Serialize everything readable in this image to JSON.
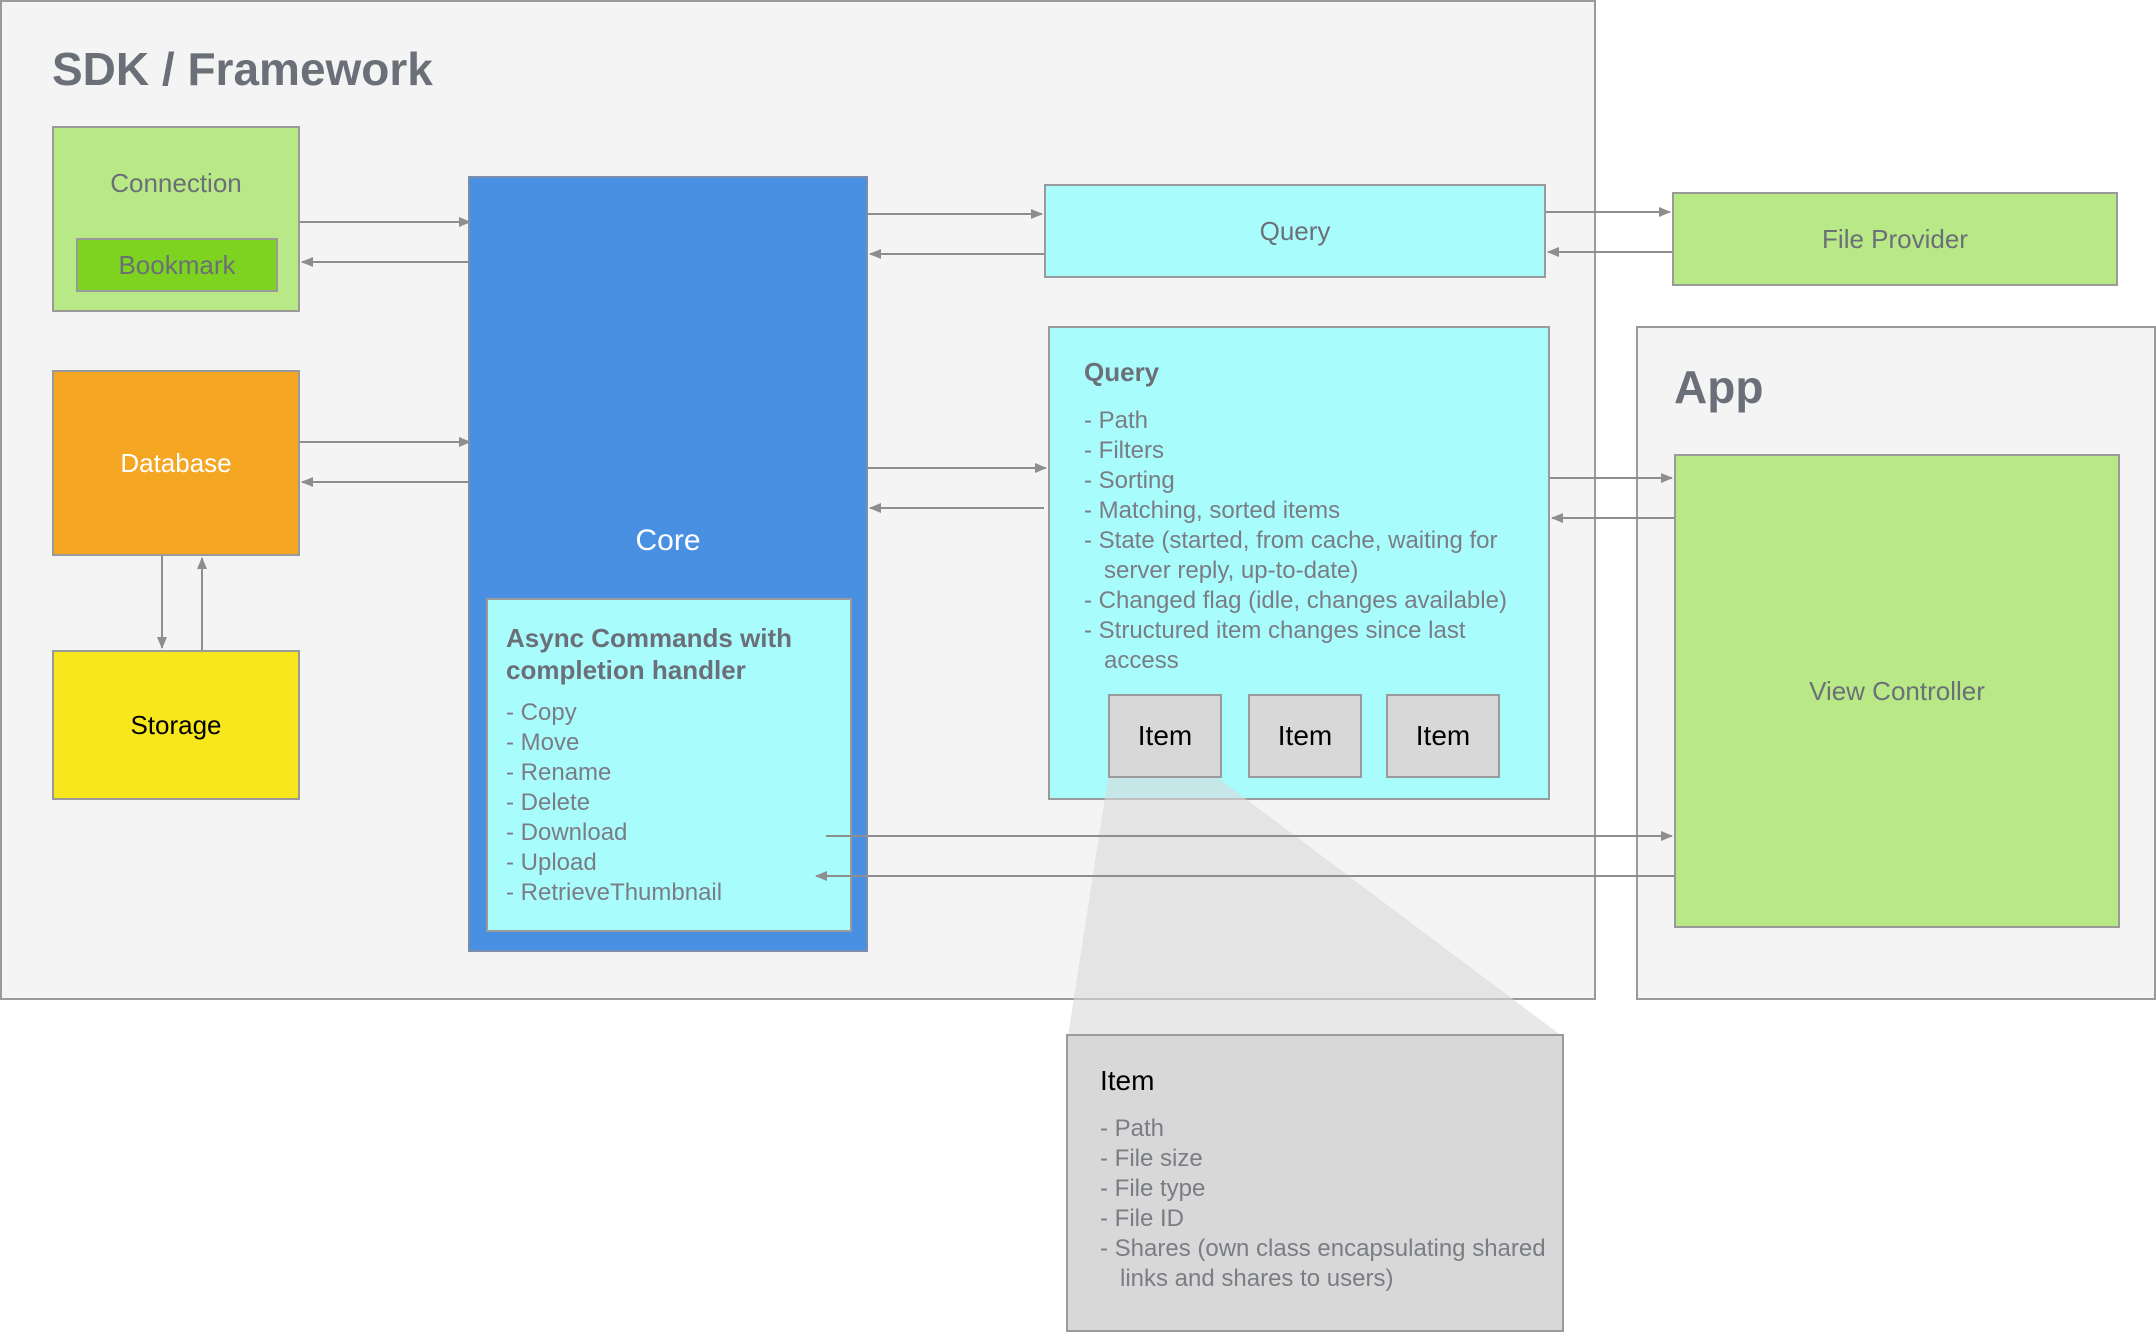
{
  "sdk": {
    "title": "SDK / Framework"
  },
  "app": {
    "title": "App",
    "view_controller": "View Controller"
  },
  "connection": {
    "label": "Connection",
    "bookmark": "Bookmark"
  },
  "database": {
    "label": "Database"
  },
  "storage": {
    "label": "Storage"
  },
  "core": {
    "label": "Core"
  },
  "async_commands": {
    "title": "Async Commands with completion handler",
    "items": [
      "- Copy",
      "- Move",
      "- Rename",
      "- Delete",
      "- Download",
      "- Upload",
      "- RetrieveThumbnail"
    ]
  },
  "query_top": {
    "label": "Query"
  },
  "file_provider": {
    "label": "File Provider"
  },
  "query_detail": {
    "title": "Query",
    "items": [
      "- Path",
      "- Filters",
      "- Sorting",
      "- Matching, sorted items",
      "- State (started, from cache, waiting for",
      "   server reply, up-to-date)",
      "- Changed flag (idle, changes available)",
      "- Structured item changes since last",
      "   access"
    ],
    "item_chips": [
      "Item",
      "Item",
      "Item"
    ]
  },
  "item_detail": {
    "title": "Item",
    "items": [
      "- Path",
      "- File size",
      "- File type",
      "- File ID",
      "- Shares (own class encapsulating shared",
      "   links and shares to users)"
    ]
  },
  "colors": {
    "group_bg": "#f4f4f4",
    "green": "#b8e986",
    "dark_green": "#7ed321",
    "orange": "#f5a623",
    "yellow": "#f8e71c",
    "blue": "#4a90e2",
    "cyan": "#a9fcfc",
    "gray": "#d8d8d8",
    "arrow": "#8e8e8e"
  }
}
